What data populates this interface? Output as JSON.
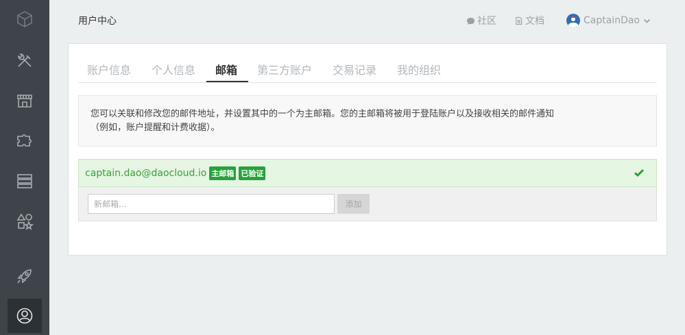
{
  "header": {
    "title": "用户中心",
    "links": [
      {
        "label": "社区",
        "icon": "comment-icon"
      },
      {
        "label": "文档",
        "icon": "document-icon"
      }
    ],
    "user": {
      "name": "CaptainDao"
    }
  },
  "sidebar": {
    "items": [
      {
        "icon": "cube-logo-icon",
        "active": false
      },
      {
        "icon": "tools-icon",
        "active": false
      },
      {
        "icon": "store-icon",
        "active": false
      },
      {
        "icon": "puzzle-icon",
        "active": false
      },
      {
        "icon": "server-icon",
        "active": false
      },
      {
        "icon": "shapes-icon",
        "active": false
      },
      {
        "icon": "rocket-icon",
        "active": false
      },
      {
        "icon": "user-icon",
        "active": true
      }
    ]
  },
  "tabs": [
    {
      "label": "账户信息",
      "active": false
    },
    {
      "label": "个人信息",
      "active": false
    },
    {
      "label": "邮箱",
      "active": true
    },
    {
      "label": "第三方账户",
      "active": false
    },
    {
      "label": "交易记录",
      "active": false
    },
    {
      "label": "我的组织",
      "active": false
    }
  ],
  "info": {
    "line1": "您可以关联和修改您的邮件地址，并设置其中的一个为主邮箱。您的主邮箱将被用于登陆账户以及接收相关的邮件通知",
    "line2": "（例如，账户提醒和计费收据）。"
  },
  "email": {
    "address": "captain.dao@daocloud.io",
    "badge_primary": "主邮箱",
    "badge_verified": "已验证"
  },
  "add": {
    "placeholder": "新邮箱...",
    "button": "添加"
  },
  "colors": {
    "sidebar_bg": "#3e4449",
    "accent_green": "#25a23a",
    "link_gray": "#9aa2a8"
  }
}
